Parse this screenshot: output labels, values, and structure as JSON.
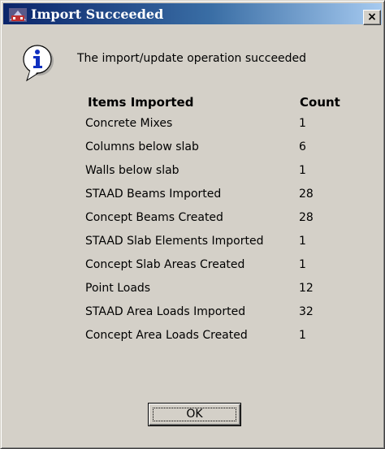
{
  "window": {
    "title": "Import Succeeded",
    "close_label": "×"
  },
  "dialog": {
    "icon": "info-icon",
    "message": "The import/update operation succeeded",
    "headers": {
      "items": "Items Imported",
      "count": "Count"
    },
    "rows": [
      {
        "name": "Concrete Mixes",
        "count": "1"
      },
      {
        "name": "Columns below slab",
        "count": "6"
      },
      {
        "name": "Walls below slab",
        "count": "1"
      },
      {
        "name": "STAAD Beams Imported",
        "count": "28"
      },
      {
        "name": "Concept Beams Created",
        "count": "28"
      },
      {
        "name": "STAAD Slab Elements Imported",
        "count": "1"
      },
      {
        "name": "Concept Slab Areas Created",
        "count": "1"
      },
      {
        "name": "Point Loads",
        "count": "12"
      },
      {
        "name": "STAAD Area Loads Imported",
        "count": "32"
      },
      {
        "name": "Concept Area Loads Created",
        "count": "1"
      }
    ],
    "ok_label": "OK"
  },
  "colors": {
    "titlebar_start": "#0a246a",
    "titlebar_end": "#a6caf0",
    "dialog_background": "#d4d0c8"
  }
}
